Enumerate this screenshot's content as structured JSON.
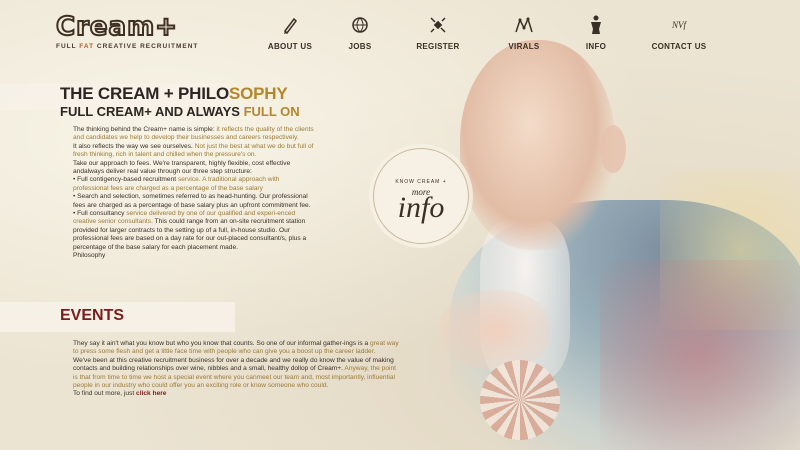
{
  "logo": {
    "name": "Cream+",
    "tagline_pre": "FULL ",
    "tagline_fat": "FAT",
    "tagline_post": " CREATIVE RECRUITMENT"
  },
  "nav": {
    "items": [
      {
        "label": "ABOUT US",
        "icon": "pencil-icon"
      },
      {
        "label": "JOBS",
        "icon": "globe-icon"
      },
      {
        "label": "REGISTER",
        "icon": "satellite-icon"
      },
      {
        "label": "VIRALS",
        "icon": "virus-icon"
      },
      {
        "label": "INFO",
        "icon": "mannequin-icon"
      },
      {
        "label": "CONTACT US",
        "icon": "nvf-icon",
        "icon_text": "NVf"
      }
    ]
  },
  "philosophy": {
    "title_main": "THE CREAM + PHILO",
    "title_accent": "SOPHY",
    "sub_main": "FULL CREAM+ AND ALWAYS ",
    "sub_accent": "FULL ON",
    "p1_a": "The thinking behind the Cream+ name is simple: ",
    "p1_hl": "it reflects the quality of the clients and candidates we help to develop their businesses and careers respectively.",
    "p2_a": "It also reflects the way we see ourselves. ",
    "p2_hl": "Not just the best at what we do but full of fresh thinking, rich in talent and chilled when the pressure's on.",
    "p3_a": "Take our approach to fees. We're transparent, highly flexible, cost effective andalways deliver real value through our three step structure:",
    "b1_a": "• Full contigency-based recruitment ",
    "b1_hl": "service. A traditional approach with professional fees are charged as a percentage of the base salary",
    "b2": "• Search and selection, sometimes referred to as head-hunting. Our professional fees are charged as a percentage of base salary plus an upfront commitment fee.",
    "b3_a": "• Full consultancy ",
    "b3_hl": "service delivered by one of our qualified and experi-enced creative senior consultants.",
    "b3_b": " This could range from an on-site recruitment station provided for larger contracts to the setting up of a full, in-house studio. Our professional fees are based on a day rate for our out-placed consultant/s, plus a percentage of the base salary for each placement made.",
    "tail": "Philosophy"
  },
  "events": {
    "title": "EVENTS",
    "p1_a": "They say it ain't what you know but who you know that counts. So one of our informal gather-ings is a ",
    "p1_hl": "great way to press some flesh and get a little face time with people who can give you a boost up the career ladder.",
    "p2_a": "We've been at this creative recruitment business for over a decade and we really do know the value of making contacts and building relationships over wine, nibbles and a small, healthy dollop of Cream+. ",
    "p2_hl": "Anyway, the point is that from time to time we host a special event where you canmeet our team and, most importantly, influential people in our industry who could offer you an exciting role or know someone who could.",
    "p3_a": "To find out more, just ",
    "p3_link": "click here"
  },
  "info_circle": {
    "know": "KNOW CREAM +",
    "more": "more",
    "big": "info"
  },
  "colors": {
    "accent_gold": "#b3872c",
    "accent_red": "#7b1c1c",
    "text": "#3a2f26",
    "background": "#ece4d2"
  }
}
